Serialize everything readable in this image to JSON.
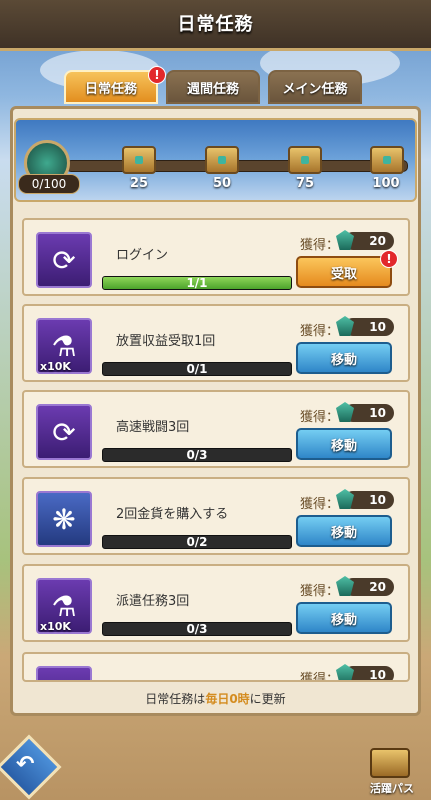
{
  "header": {
    "title": "日常任務"
  },
  "tabs": [
    {
      "label": "日常任務",
      "active": true,
      "badge": "!"
    },
    {
      "label": "週間任務",
      "active": false
    },
    {
      "label": "メイン任務",
      "active": false
    }
  ],
  "activity": {
    "score": "0/100",
    "milestones": [
      "25",
      "50",
      "75",
      "100"
    ]
  },
  "reward_label": "獲得：",
  "tasks": [
    {
      "name": "ログイン",
      "progress": "1/1",
      "progress_fraction": 1.0,
      "reward": "20",
      "button": "受取",
      "button_type": "claim",
      "badge": "!",
      "item_icon": "scroll-icon",
      "qty": ""
    },
    {
      "name": "放置収益受取1回",
      "progress": "0/1",
      "progress_fraction": 0,
      "reward": "10",
      "button": "移動",
      "button_type": "move",
      "item_icon": "potion-icon",
      "qty": "x10K"
    },
    {
      "name": "高速戦闘3回",
      "progress": "0/3",
      "progress_fraction": 0,
      "reward": "10",
      "button": "移動",
      "button_type": "move",
      "item_icon": "scroll-icon",
      "qty": ""
    },
    {
      "name": "2回金貨を購入する",
      "progress": "0/2",
      "progress_fraction": 0,
      "reward": "10",
      "button": "移動",
      "button_type": "move",
      "item_icon": "card-icon",
      "qty": ""
    },
    {
      "name": "派遣任務3回",
      "progress": "0/3",
      "progress_fraction": 0,
      "reward": "20",
      "button": "移動",
      "button_type": "move",
      "item_icon": "potion-icon",
      "qty": "x10K"
    },
    {
      "name": "",
      "progress": "",
      "progress_fraction": 0,
      "reward": "10",
      "button": "",
      "button_type": "move",
      "item_icon": "scroll-icon",
      "qty": ""
    }
  ],
  "footer": {
    "prefix": "日常任務は",
    "highlight": "毎日0時",
    "suffix": "に更新"
  },
  "bottom": {
    "pass_label": "活躍パス"
  },
  "colors": {
    "accent": "#e28e1f",
    "move_button": "#2f86c8",
    "claim_button": "#e58a1e",
    "progress_fill": "#4ca32b"
  }
}
